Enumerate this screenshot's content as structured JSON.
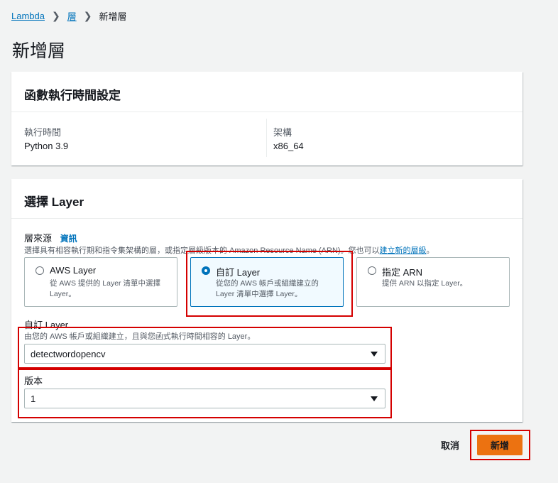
{
  "breadcrumb": {
    "root": "Lambda",
    "parent": "層",
    "current": "新增層"
  },
  "page_title": "新增層",
  "runtime_settings": {
    "title": "函數執行時間設定",
    "runtime_label": "執行時間",
    "runtime_value": "Python 3.9",
    "arch_label": "架構",
    "arch_value": "x86_64"
  },
  "choose_layer": {
    "title": "選擇 Layer",
    "source_label": "層來源",
    "info_link": "資訊",
    "source_desc_prefix": "選擇具有相容執行期和指令集架構的層，或指定層級版本的 Amazon Resource Name (ARN)。您也可以",
    "source_desc_link": "建立新的層級",
    "source_desc_suffix": "。",
    "options": [
      {
        "title": "AWS Layer",
        "desc": "從 AWS 提供的 Layer 清單中選擇 Layer。",
        "selected": false
      },
      {
        "title": "自訂 Layer",
        "desc": "從您的 AWS 帳戶或組織建立的 Layer 清單中選擇 Layer。",
        "selected": true
      },
      {
        "title": "指定 ARN",
        "desc": "提供 ARN 以指定 Layer。",
        "selected": false
      }
    ],
    "custom_layer_label": "自訂 Layer",
    "custom_layer_desc": "由您的 AWS 帳戶或組織建立，且與您函式執行時間相容的 Layer。",
    "custom_layer_value": "detectwordopencv",
    "version_label": "版本",
    "version_value": "1"
  },
  "footer": {
    "cancel_label": "取消",
    "submit_label": "新增"
  },
  "colors": {
    "link": "#0073bb",
    "primary": "#ec7211",
    "highlight": "#d40000"
  }
}
